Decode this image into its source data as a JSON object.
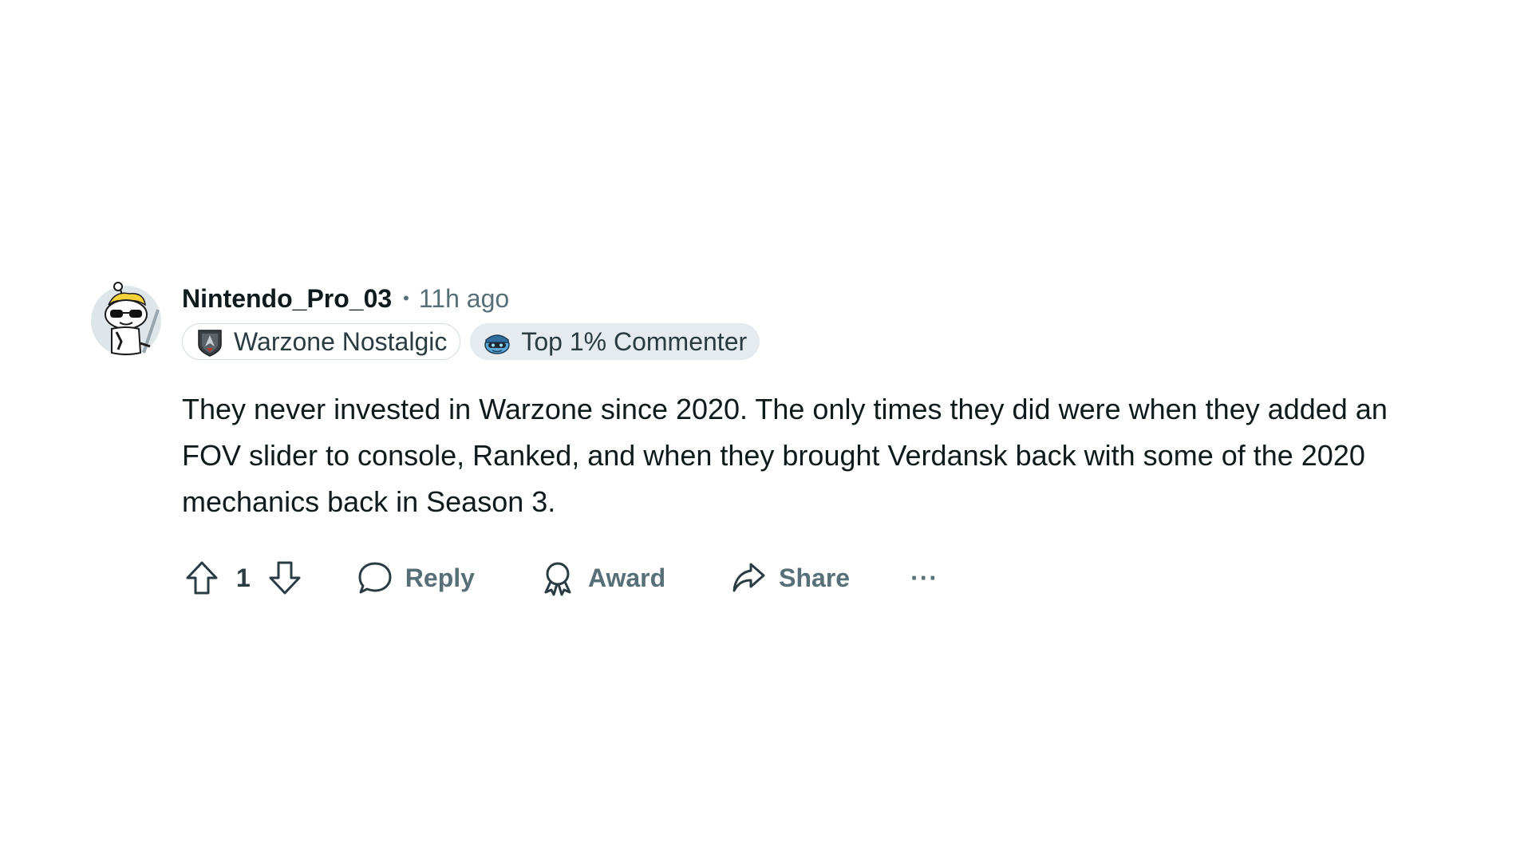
{
  "comment": {
    "author": "Nintendo_Pro_03",
    "separator": "•",
    "timestamp": "11h ago",
    "flairs": [
      {
        "label": "Warzone Nostalgic",
        "icon": "warzone-emblem-icon"
      },
      {
        "label": "Top 1% Commenter",
        "icon": "top-commenter-icon"
      }
    ],
    "body": "They never invested in Warzone since 2020. The only times they did were when they added an FOV slider to console, Ranked, and when they brought Verdansk back with some of the 2020 mechanics back in Season 3.",
    "actions": {
      "vote_count": "1",
      "reply_label": "Reply",
      "award_label": "Award",
      "share_label": "Share",
      "more_label": "···"
    }
  },
  "colors": {
    "text_primary": "#0f1a1c",
    "text_secondary": "#576f76",
    "flair_top_bg": "#e5ebee",
    "flair_border": "#d6dde0"
  }
}
